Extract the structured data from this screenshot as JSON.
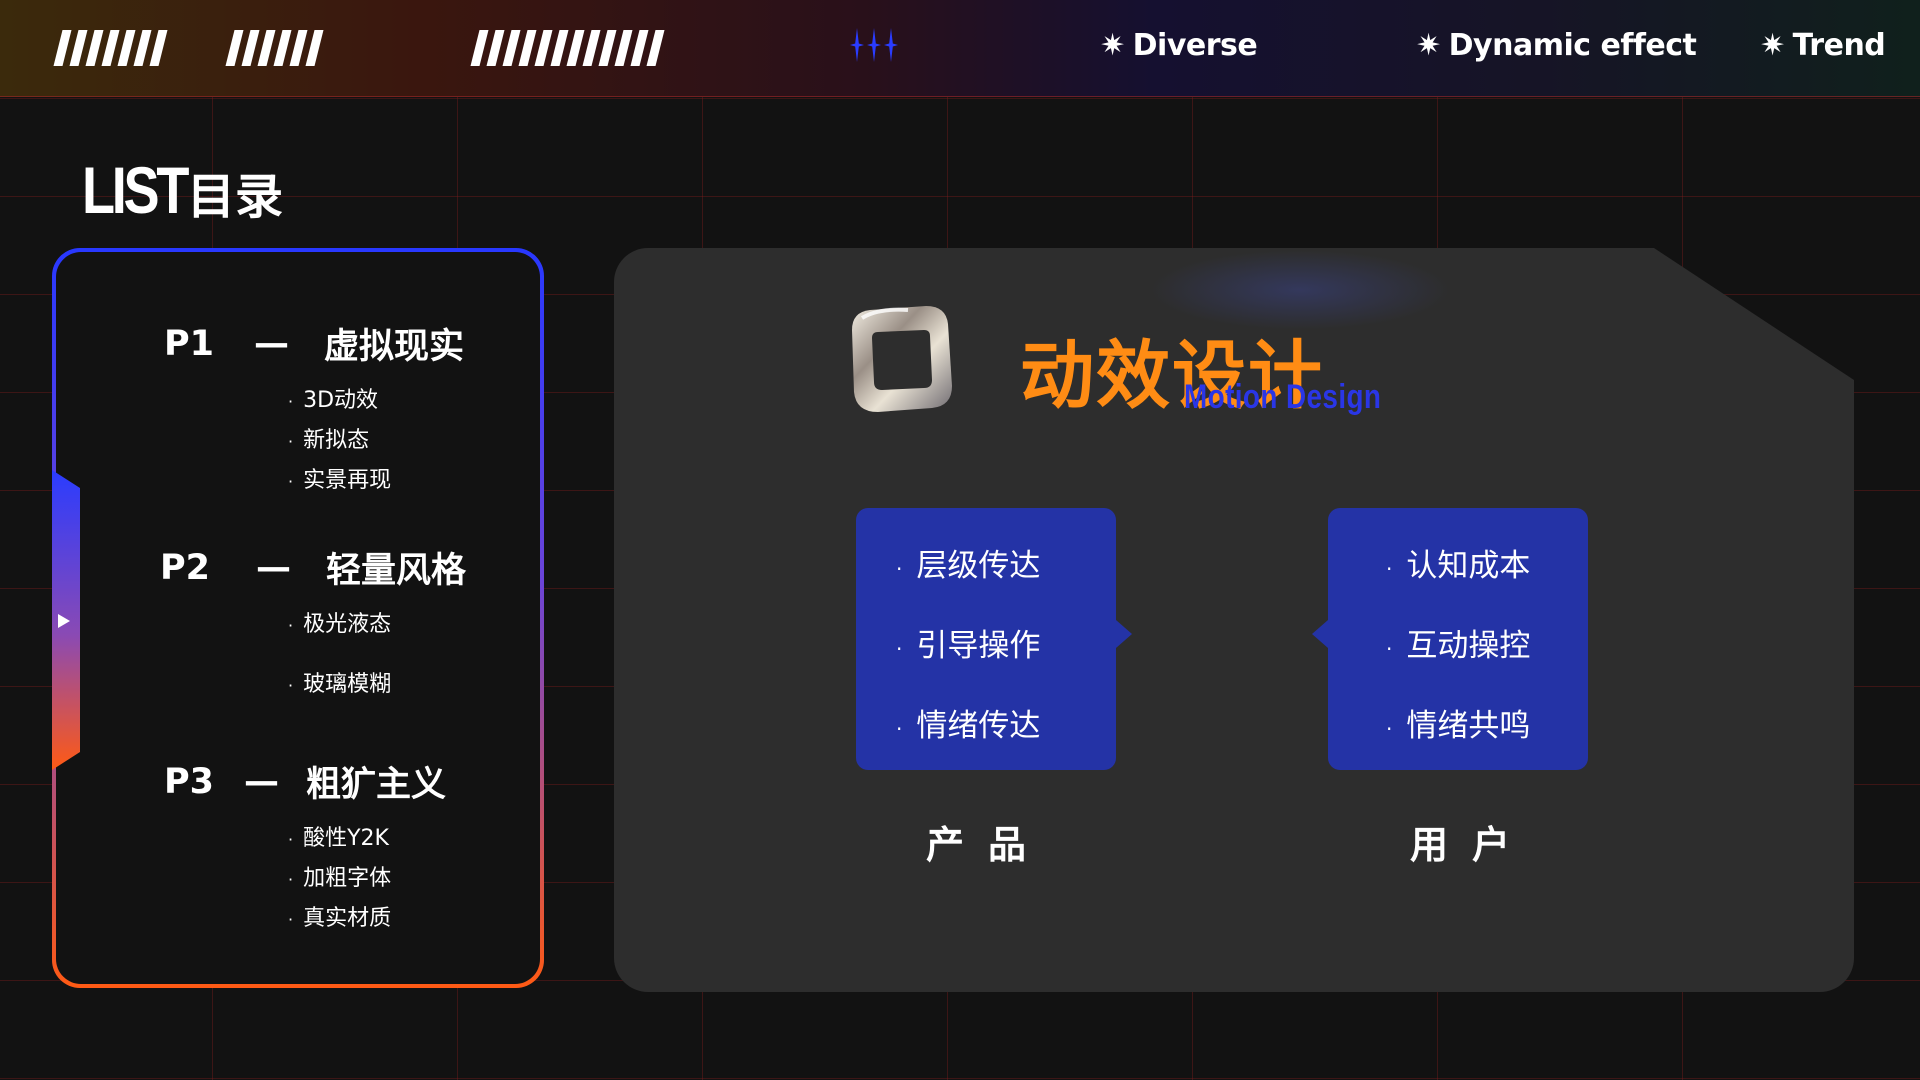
{
  "colors": {
    "accent_orange": "#ff8c14",
    "accent_blue": "#2a36e6",
    "card_blue": "#2433a6",
    "panel_bg": "#2d2d2d",
    "page_bg": "#121212"
  },
  "topbar": {
    "tags": [
      {
        "icon": "star-icon",
        "label": "Diverse"
      },
      {
        "icon": "star-icon",
        "label": "Dynamic effect"
      },
      {
        "icon": "star-icon",
        "label": "Trend"
      }
    ]
  },
  "list": {
    "title_en": "LIST",
    "title_zh": "目录",
    "sections": [
      {
        "num": "P1",
        "dash": "—",
        "name": "虚拟现实",
        "items": [
          "3D动效",
          "新拟态",
          "实景再现"
        ]
      },
      {
        "num": "P2",
        "dash": "—",
        "name": "轻量风格",
        "items": [
          "极光液态",
          "玻璃模糊"
        ]
      },
      {
        "num": "P3",
        "dash": "—",
        "name": "粗犷主义",
        "items": [
          "酸性Y2K",
          "加粗字体",
          "真实材质"
        ]
      }
    ]
  },
  "main": {
    "title_zh": "动效设计",
    "title_en": "Motion Design",
    "cards": [
      {
        "label": "产品",
        "items": [
          "层级传达",
          "引导操作",
          "情绪传达"
        ]
      },
      {
        "label": "用户",
        "items": [
          "认知成本",
          "互动操控",
          "情绪共鸣"
        ]
      }
    ]
  }
}
